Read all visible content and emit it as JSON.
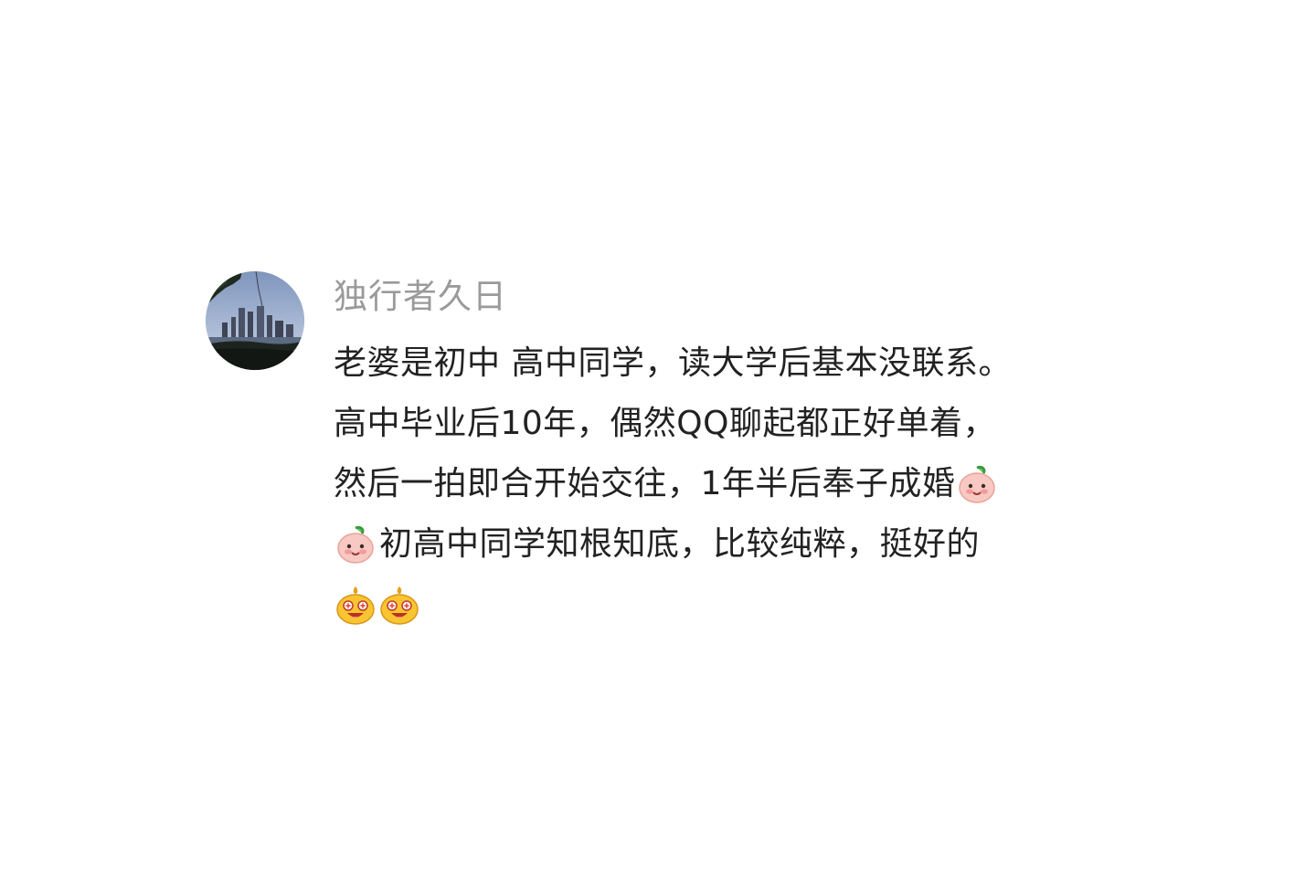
{
  "comment": {
    "author": "独行者久日",
    "lines": [
      "老婆是初中 高中同学，读大学后基本没联系。",
      "高中毕业后10年，偶然QQ聊起都正好单着，",
      "然后一拍即合开始交往，1年半后奉子成婚",
      "初高中同学知根知底，比较纯粹，挺好的"
    ],
    "emojis": {
      "line3_end": "blush-face-emoji",
      "line4_start": "blush-face-emoji",
      "line5": [
        "excited-face-emoji",
        "excited-face-emoji"
      ]
    },
    "avatar": "city-skyline-avatar"
  },
  "colors": {
    "author": "#9a9a9a",
    "text": "#222222",
    "background": "#ffffff"
  }
}
